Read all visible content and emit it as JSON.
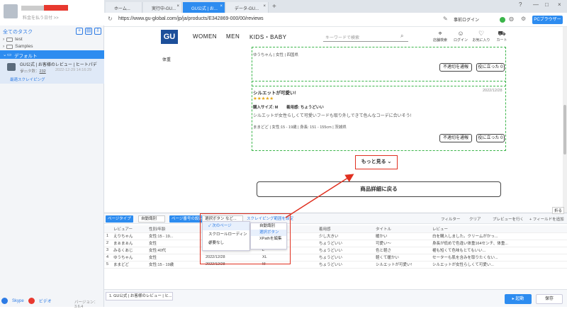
{
  "left_panel": {
    "account_sub": "料金を払う日付 >>",
    "all_tasks": "全てのタスク",
    "tree": [
      "test",
      "Samples"
    ],
    "selected_folder": "デフォルト",
    "task": {
      "title": "GU公式 | お客様のレビュー | ヒートパデッ...",
      "count_label": "データ数：",
      "count": "232",
      "date": "2022-12-29 14:16:29",
      "action": "最適スクレイピング"
    },
    "footer": {
      "skype": "Skype",
      "video": "ビデオ",
      "version": "バージョン：3.6.4"
    }
  },
  "tabs": [
    {
      "label": "ホーム..."
    },
    {
      "label": "実行中-GU..."
    },
    {
      "label": "GU公式 | お..."
    },
    {
      "label": "データ-GU..."
    }
  ],
  "address": {
    "url": "https://www.gu-global.com/jp/ja/products/E342869-000/00/reviews",
    "login": "事前ログイン",
    "browser_btn": "PCブラウザー"
  },
  "web": {
    "logo": "GU",
    "menu": [
      "WOMEN",
      "MEN",
      "KIDS・BABY"
    ],
    "search_placeholder": "キーワードで検索",
    "header_icons": [
      "店舗検索",
      "ログイン",
      "お気に入り",
      "カート"
    ],
    "weight_label": "体重",
    "review1_meta": "ゆうちゃん | 女性 | 四国県",
    "report_label": "不適切を通報",
    "helpful_label": "役に立った 0",
    "review2": {
      "title": "シルエットが可愛い!",
      "date": "2022/12/28",
      "stars": "★★★★★",
      "size_label": "購入サイズ: M",
      "fit_label": "着用感: ちょうどいい",
      "body": "シルエットが女性らしくて可愛いフードも取り外しできて色んなコーデに合いそう!",
      "meta": "ままどど | 女性:15 - 19歳 | 身長: 151 - 155cm | 茨城県"
    },
    "more": "もっと見る",
    "back": "商品詳細に戻る"
  },
  "data_panel": {
    "page_type_label": "ページタイプ",
    "page_type_value": "自動識別",
    "page_no_label": "ページ番号の設定",
    "select_button": "選択ボタン など...",
    "scrape_range": "スクレイピング範囲を設定",
    "filter": "フィルター",
    "clear": "クリア",
    "preview": "プレビューを行く",
    "add_field": "+ フィールドを追加",
    "fold": "折る",
    "columns": [
      "",
      "レビュアー",
      "性別/年齢",
      "日付",
      "購入サイズ",
      "着用感",
      "タイトル",
      "レビュー"
    ],
    "rows": [
      [
        "1",
        "えりちゃん",
        "女性:15 - 19...",
        "",
        "M",
        "少し大きい",
        "暖かい",
        "白を購入しました。クリームがかっ..."
      ],
      [
        "2",
        "まぁまぁん",
        "女性",
        "",
        "XL",
        "ちょうどいい",
        "可愛い〜",
        "身長が低めで色違い体重164センチ、体重..."
      ],
      [
        "3",
        "みるくあじ",
        "女性:40代",
        "",
        "L",
        "ちょうどいい",
        "色と軽さ",
        "裾も短くて色味もとてもいい..."
      ],
      [
        "4",
        "ゆうちゃん",
        "女性",
        "2022/12/28",
        "XL",
        "ちょうどいい",
        "軽くて暖かい",
        "セーターも肌を含みを取りたくない..."
      ],
      [
        "5",
        "ままどど",
        "女性:15 - 19歳",
        "2022/12/28",
        "M",
        "ちょうどいい",
        "シルエットが可愛い!",
        "シルエットが女性らしくて可愛い..."
      ]
    ],
    "dropdown": [
      "次のページ",
      "スクロールローディング",
      "必要なし"
    ],
    "dropdown2": [
      "自動識別",
      "選択ボタン",
      "XPathを編集"
    ]
  },
  "bottom": {
    "tab": "1. GU公式 | お客様のレビュー | ヒ...",
    "start": "起動",
    "save": "保存"
  }
}
